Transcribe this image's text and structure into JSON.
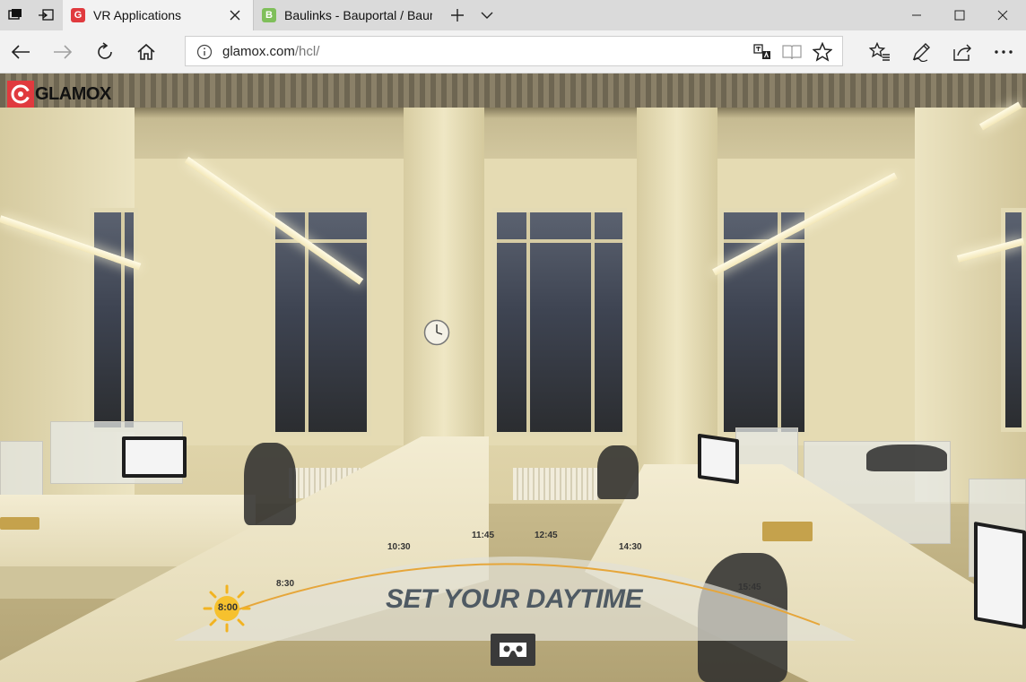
{
  "browser": {
    "tabs": [
      {
        "title": "VR Applications",
        "favicon_letter": "G",
        "favicon_color": "#e03a3e",
        "active": true
      },
      {
        "title": "Baulinks - Bauportal / Baum",
        "favicon_letter": "B",
        "favicon_color": "#7fbf5a",
        "active": false
      }
    ],
    "address": {
      "host": "glamox.com",
      "path": "/hcl/"
    }
  },
  "page": {
    "logo_text": "GLAMOX",
    "brand_color": "#e03a3e",
    "daytime": {
      "headline": "SET YOUR DAYTIME",
      "selected_time": "8:00",
      "times": [
        "8:30",
        "10:30",
        "11:45",
        "12:45",
        "14:30",
        "15:45"
      ]
    }
  },
  "icons": {
    "tab_actions": "tab-actions-icon",
    "set_aside": "set-aside-tabs-icon",
    "vr": "vr-headset-icon"
  }
}
